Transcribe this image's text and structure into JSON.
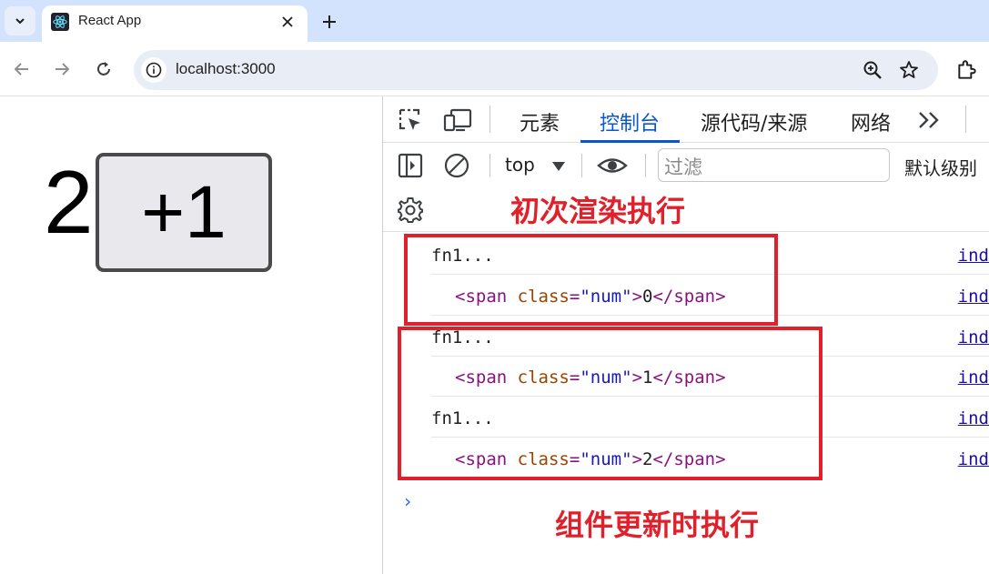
{
  "browser": {
    "tab_title": "React App",
    "url": "localhost:3000"
  },
  "page": {
    "count": "2",
    "button_label": "+1"
  },
  "devtools": {
    "tabs": [
      "元素",
      "控制台",
      "源代码/来源",
      "网络"
    ],
    "active_tab": "控制台",
    "context": "top",
    "filter_placeholder": "过滤",
    "levels_label": "默认级别",
    "console_rows": [
      {
        "type": "text",
        "text": "fn1...",
        "source": "ind"
      },
      {
        "type": "element",
        "tag": "span",
        "attr": "class",
        "attr_value": "num",
        "content": "0",
        "source": "ind"
      },
      {
        "type": "text",
        "text": "fn1...",
        "source": "ind"
      },
      {
        "type": "element",
        "tag": "span",
        "attr": "class",
        "attr_value": "num",
        "content": "1",
        "source": "ind"
      },
      {
        "type": "text",
        "text": "fn1...",
        "source": "ind"
      },
      {
        "type": "element",
        "tag": "span",
        "attr": "class",
        "attr_value": "num",
        "content": "2",
        "source": "ind"
      }
    ],
    "prompt_symbol": "›"
  },
  "annotations": {
    "initial_render": "初次渲染执行",
    "on_update": "组件更新时执行",
    "color": "#e0202a"
  },
  "colors": {
    "tabstrip": "#d3e3fd",
    "accent": "#0b57d0"
  }
}
